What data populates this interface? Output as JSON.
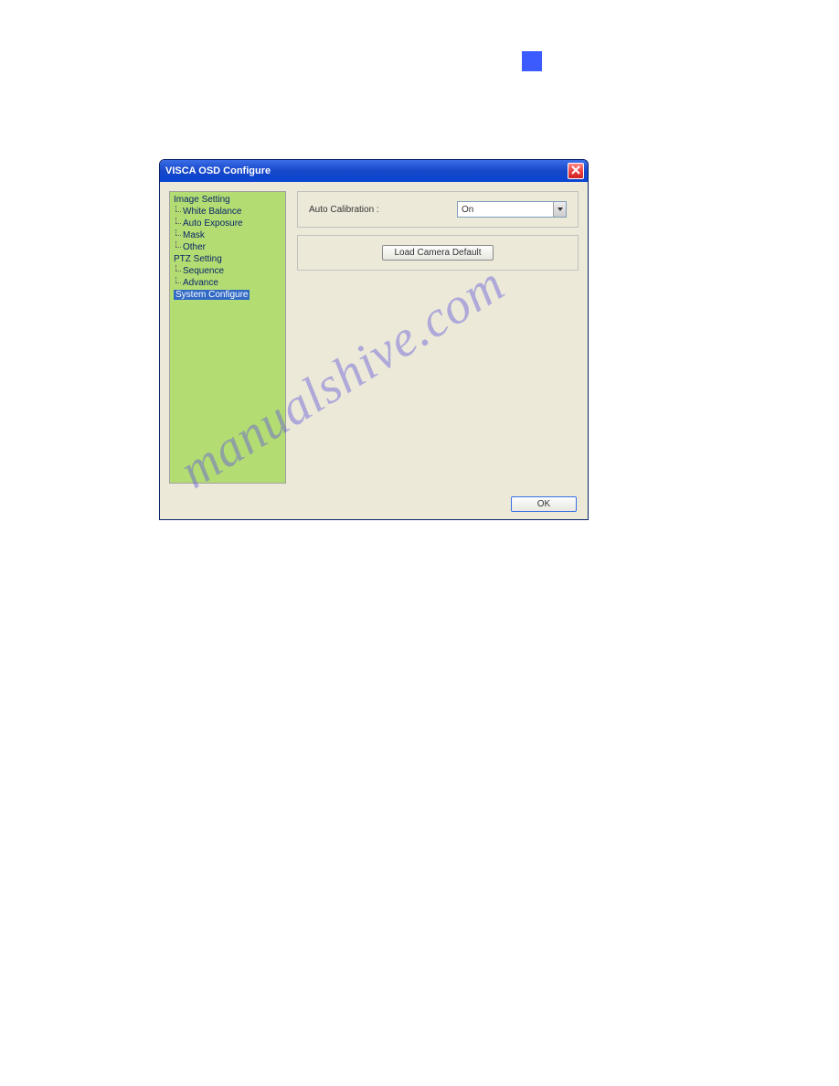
{
  "dialog": {
    "title": "VISCA OSD Configure",
    "tree": {
      "image_setting": "Image Setting",
      "white_balance": "White Balance",
      "auto_exposure": "Auto Exposure",
      "mask": "Mask",
      "other": "Other",
      "ptz_setting": "PTZ Setting",
      "sequence": "Sequence",
      "advance": "Advance",
      "system_configure": "System Configure"
    },
    "content": {
      "auto_calibration_label": "Auto Calibration :",
      "auto_calibration_value": "On",
      "load_default_button": "Load Camera Default"
    },
    "footer": {
      "ok_button": "OK"
    }
  },
  "watermark": "manualshive.com"
}
